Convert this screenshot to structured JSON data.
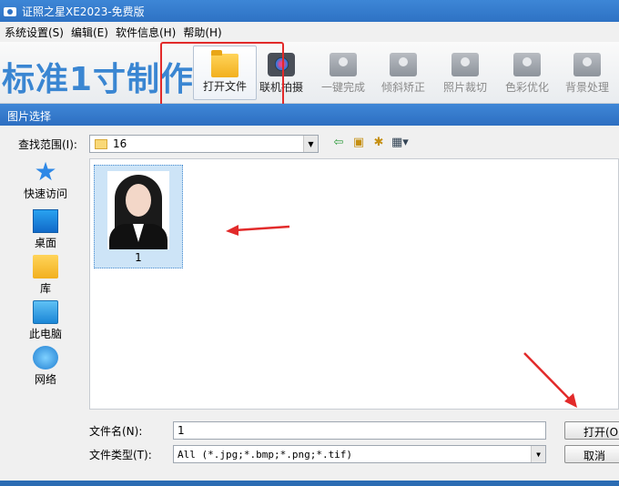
{
  "window": {
    "title": "证照之星XE2023-免费版"
  },
  "menu": [
    {
      "label": "系统设置(S)"
    },
    {
      "label": "编辑(E)"
    },
    {
      "label": "软件信息(H)"
    },
    {
      "label": "帮助(H)"
    }
  ],
  "brand": "标准1寸制作",
  "toolbar": [
    {
      "label": "打开文件",
      "icon": "folder-icon",
      "active": true
    },
    {
      "label": "联机拍摄",
      "icon": "camera-icon"
    },
    {
      "label": "一键完成",
      "icon": "film-icon",
      "disabled": true
    },
    {
      "label": "倾斜矫正",
      "icon": "tilt-icon",
      "disabled": true
    },
    {
      "label": "照片裁切",
      "icon": "crop-icon",
      "disabled": true
    },
    {
      "label": "色彩优化",
      "icon": "color-icon",
      "disabled": true
    },
    {
      "label": "背景处理",
      "icon": "background-icon",
      "disabled": true
    }
  ],
  "dialog": {
    "title": "图片选择",
    "look_in_label": "查找范围(I):",
    "look_in_value": "16",
    "places": [
      {
        "label": "快速访问",
        "icon": "star-icon"
      },
      {
        "label": "桌面",
        "icon": "desktop-icon"
      },
      {
        "label": "库",
        "icon": "library-icon"
      },
      {
        "label": "此电脑",
        "icon": "computer-icon"
      },
      {
        "label": "网络",
        "icon": "network-icon"
      }
    ],
    "files": [
      {
        "name": "1"
      }
    ],
    "file_name_label": "文件名(N):",
    "file_name_value": "1",
    "file_type_label": "文件类型(T):",
    "file_type_value": "All (*.jpg;*.bmp;*.png;*.tif)",
    "open_button": "打开(O)",
    "cancel_button": "取消"
  },
  "colors": {
    "accent": "#2e72c4",
    "highlight": "#e22a2a",
    "brand": "#3a86d2"
  }
}
